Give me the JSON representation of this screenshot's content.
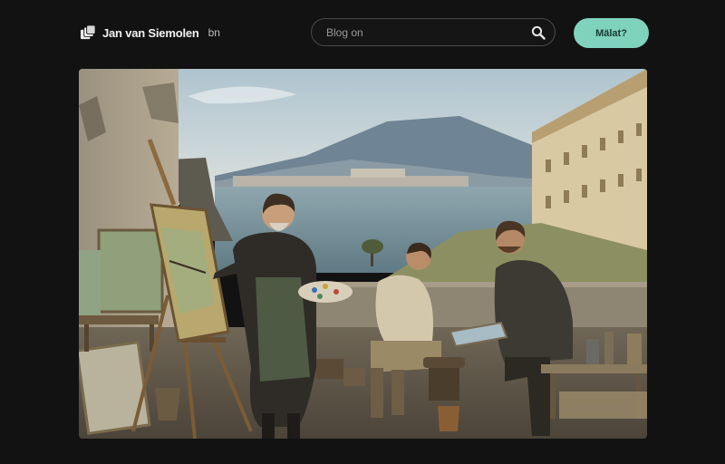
{
  "header": {
    "brand_name": "Jan van Siemolen",
    "brand_suffix": "bn",
    "logo_icon": "stacked-pages-icon",
    "search": {
      "placeholder": "Blog on",
      "icon": "search-icon"
    },
    "cta_label": "Mälat?"
  },
  "hero": {
    "image_alt": "",
    "colors": {
      "accent": "#7fd3bd",
      "background": "#121212"
    }
  }
}
